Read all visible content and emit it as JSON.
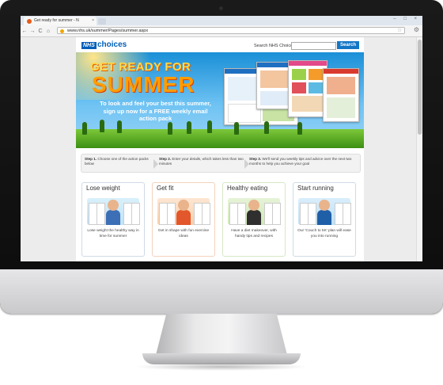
{
  "browser": {
    "tab_title": "Get ready for summer - N",
    "tab_close": "×",
    "url": "www.nhs.uk/summer/Pages/summer.aspx",
    "nav": {
      "back": "←",
      "forward": "→",
      "reload": "C",
      "home": "⌂"
    },
    "window_controls": "– □ ×"
  },
  "header": {
    "logo_nhs": "NHS",
    "logo_choices": "choices",
    "search_label": "Search NHS Choices:",
    "search_placeholder": "",
    "search_button": "Search"
  },
  "hero": {
    "title_line1": "GET READY FOR",
    "title_line2": "SUMMER",
    "subtitle": "To look and feel your best this summer, sign up now for a FREE weekly email action pack"
  },
  "steps": [
    {
      "label": "Step 1.",
      "text": "Choose one of the action packs below"
    },
    {
      "label": "Step 2.",
      "text": "Enter your details, which takes less than two minutes"
    },
    {
      "label": "Step 3.",
      "text": "We'll send you weekly tips and advice over the next two months to help you achieve your goal"
    }
  ],
  "cards": [
    {
      "title": "Lose weight",
      "desc": "Lose weight the healthy way in time for summer"
    },
    {
      "title": "Get fit",
      "desc": "Get in shape with fun exercise ideas"
    },
    {
      "title": "Healthy eating",
      "desc": "Have a diet makeover, with handy tips and recipes"
    },
    {
      "title": "Start running",
      "desc": "Our 'Couch to 5K' plan will ease you into running"
    }
  ],
  "colors": {
    "nhs_blue": "#005eb8",
    "hero_orange": "#ff9d00",
    "grass_green": "#5aad22"
  }
}
